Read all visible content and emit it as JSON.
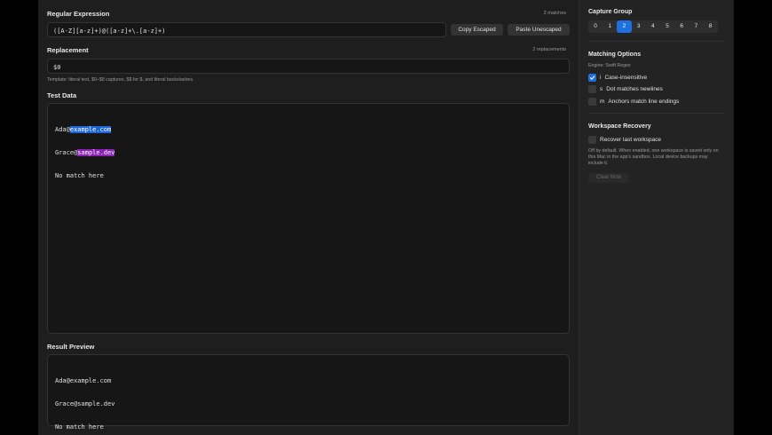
{
  "regex": {
    "label": "Regular Expression",
    "match_count": "2 matches",
    "pattern": "([A-Z][a-z]+)@([a-z]+\\.[a-z]+)",
    "copy_escaped": "Copy Escaped",
    "paste_unescaped": "Paste Unescaped"
  },
  "replacement": {
    "label": "Replacement",
    "count": "2 replacements",
    "value": "$0",
    "hint": "Template: literal text, $0–$8 captures, $$ for $, and literal backslashes."
  },
  "test_data": {
    "label": "Test Data",
    "lines": [
      {
        "prefix": "Ada@",
        "highlight": "example.com",
        "color": "#1e66d8"
      },
      {
        "prefix": "Grace@",
        "highlight": "sample.dev",
        "color": "#8a22b8"
      },
      {
        "prefix": "No match here",
        "highlight": "",
        "color": ""
      }
    ]
  },
  "result": {
    "label": "Result Preview",
    "lines": [
      "Ada@example.com",
      "Grace@sample.dev",
      "No match here"
    ]
  },
  "sidebar": {
    "capture_group": {
      "title": "Capture Group",
      "options": [
        "0",
        "1",
        "2",
        "3",
        "4",
        "5",
        "6",
        "7",
        "8"
      ],
      "selected": "2"
    },
    "matching": {
      "title": "Matching Options",
      "engine": "Engine: Swift Regex",
      "options": [
        {
          "flag": "i",
          "label": "Case-insensitive",
          "checked": true
        },
        {
          "flag": "s",
          "label": "Dot matches newlines",
          "checked": false
        },
        {
          "flag": "m",
          "label": "Anchors match line endings",
          "checked": false
        }
      ]
    },
    "recovery": {
      "title": "Workspace Recovery",
      "option": "Recover last workspace",
      "checked": false,
      "description": "Off by default. When enabled, one workspace is saved only on this Mac in the app's sandbox. Local device backups may include it.",
      "clear_label": "Clear Now"
    }
  },
  "colors": {
    "accent": "#1f6fe0",
    "highlight_blue": "#1e66d8",
    "highlight_purple": "#8a22b8"
  }
}
